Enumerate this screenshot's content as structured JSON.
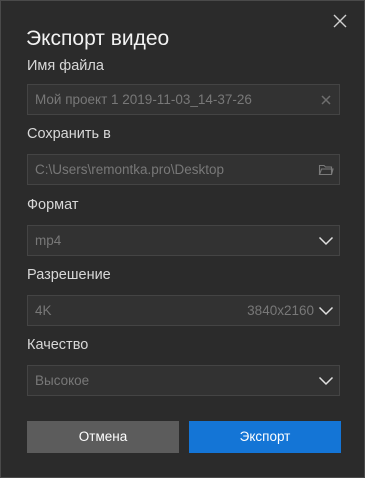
{
  "dialog": {
    "title": "Экспорт видео",
    "close_icon": "close-icon"
  },
  "file_name": {
    "label": "Имя файла",
    "value": "Мой проект 1 2019-11-03_14-37-26",
    "clear_icon": "clear-icon"
  },
  "save_to": {
    "label": "Сохранить в",
    "value": "C:\\Users\\remontka.pro\\Desktop",
    "folder_icon": "folder-icon"
  },
  "format": {
    "label": "Формат",
    "selected": "mp4"
  },
  "resolution": {
    "label": "Разрешение",
    "selected": "4K",
    "detail": "3840x2160"
  },
  "quality": {
    "label": "Качество",
    "selected": "Высокое"
  },
  "buttons": {
    "cancel": "Отмена",
    "export": "Экспорт"
  },
  "colors": {
    "background": "#2b2b2b",
    "field_background": "#323232",
    "cancel_button": "#5c5c5c",
    "accent": "#1475d6"
  }
}
